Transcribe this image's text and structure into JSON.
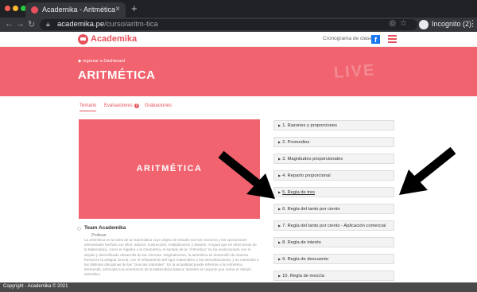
{
  "browser": {
    "tab_title": "Academika - Aritmética",
    "tab_close": "×",
    "new_tab": "+",
    "back": "←",
    "forward": "→",
    "reload": "↻",
    "url_host": "academika.pe",
    "url_path": "/curso/aritm-tica",
    "omnibox_icons": [
      "eye-off-icon",
      "star-icon"
    ],
    "profile_label": "Incognito (2)",
    "menu": "⋮"
  },
  "site": {
    "logo_text": "Academika",
    "nav_link": "Cronograma de clases",
    "fb": "f"
  },
  "banner": {
    "breadcrumb": "◆ regresar a Dashboard",
    "title": "ARITMÉTICA",
    "deco": "LIVE"
  },
  "tabs": {
    "temario": "Temario",
    "evaluaciones": "Evaluaciones",
    "evaluaciones_badge": "0",
    "grabaciones": "Grabaciones"
  },
  "video": {
    "title": "ARITMÉTICA"
  },
  "author": {
    "name": "Team Academika",
    "role": "Profesor",
    "description": "La aritmética es la rama de la matemática cuyo objeto de estudio son los números y las operaciones elementales hechas con ellos: adición, sustracción, multiplicación y división. Al igual que en otras áreas de la Matemática, como el Álgebra o la Geometría, el sentido de la \"Aritmética\" no ha evolucionado con el amplio y diversificado desarrollo de las ciencias. Originalmente, la aritmética se desarrolló de manera formal en la antigua Grecia, con el refinamiento del rigor matemático y las demostraciones, y su extensión a las distintas disciplinas de las \"ciencias naturales\". En la actualidad puede referirse a la Aritmética Elemental, enfocada a la enseñanza de la Matemática básica; también al conjunto que reúna el cálculo aritmético."
  },
  "topics": [
    "1. Razones y proporciones",
    "2. Promedios",
    "3. Magnitudes proporcionales",
    "4. Reparto proporcional",
    "5. Regla de tres",
    "6. Regla del tanto por ciento",
    "7. Regla del tanto por ciento - Aplicación comercial",
    "8. Regla de interés",
    "9. Regla de descuento",
    "10. Regla de mezcla"
  ],
  "footer": {
    "copyright": "Copyright - Academika © 2021"
  },
  "colors": {
    "brand": "#e8505b",
    "banner": "#f0636f",
    "footer": "#4a4a4a"
  }
}
